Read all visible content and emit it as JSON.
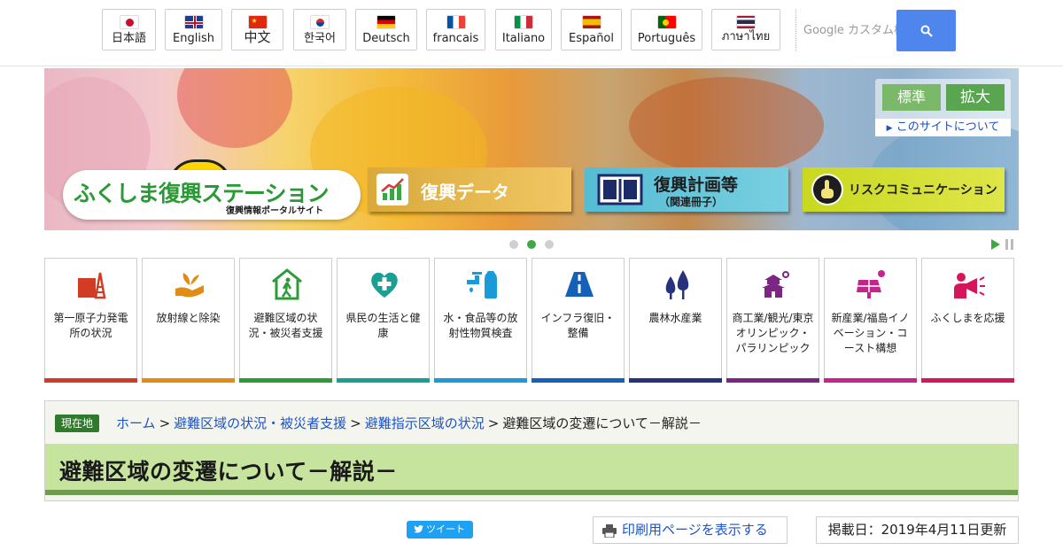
{
  "languages": [
    {
      "label": "日本語",
      "flag": "jp"
    },
    {
      "label": "English",
      "flag": "uk"
    },
    {
      "label": "中文",
      "flag": "cn"
    },
    {
      "label": "한국어",
      "flag": "kr"
    },
    {
      "label": "Deutsch",
      "flag": "de"
    },
    {
      "label": "francais",
      "flag": "fr"
    },
    {
      "label": "Italiano",
      "flag": "it"
    },
    {
      "label": "Español",
      "flag": "es"
    },
    {
      "label": "Português",
      "flag": "pt"
    },
    {
      "label": "ภาษาไทย",
      "flag": "th"
    }
  ],
  "search": {
    "placeholder": "Google カスタム検索",
    "icon": "search-icon",
    "button_color": "#4f86ee"
  },
  "hero": {
    "logo_title": "ふくしま復興ステーション",
    "logo_subtitle": "復興情報ポータルサイト",
    "buttons": [
      {
        "label": "復興データ",
        "icon": "chart-icon"
      },
      {
        "label": "復興計画等",
        "sublabel": "（関連冊子）",
        "icon": "book-icon"
      },
      {
        "label": "リスクコミュニケーション",
        "icon": "hand-icon"
      }
    ],
    "font_size": {
      "standard": "標準",
      "large": "拡大"
    },
    "about_link": "このサイトについて",
    "slider": {
      "total": 3,
      "active": 2
    }
  },
  "categories": [
    {
      "label": "第一原子力発電所の状況",
      "color": "#d33c24",
      "icon": "power-plant-icon"
    },
    {
      "label": "放射線と除染",
      "color": "#e38c14",
      "icon": "hand-sprout-icon"
    },
    {
      "label": "避難区域の状況・被災者支援",
      "color": "#2f9a3a",
      "icon": "evacuation-house-icon"
    },
    {
      "label": "県民の生活と健康",
      "color": "#1a9f93",
      "icon": "health-heart-icon"
    },
    {
      "label": "水・食品等の放射性物質検査",
      "color": "#1a9ad6",
      "icon": "water-milk-icon"
    },
    {
      "label": "インフラ復旧・整備",
      "color": "#1560b8",
      "icon": "road-icon"
    },
    {
      "label": "農林水産業",
      "color": "#27327c",
      "icon": "trees-icon"
    },
    {
      "label": "商工業/観光/東京オリンピック・パラリンピック",
      "color": "#7a2682",
      "icon": "castle-icon"
    },
    {
      "label": "新産業/福島イノベーション・コースト構想",
      "color": "#c5248a",
      "icon": "solar-panel-icon"
    },
    {
      "label": "ふくしまを応援",
      "color": "#d6165a",
      "icon": "megaphone-icon"
    }
  ],
  "breadcrumb": {
    "here_label": "現在地",
    "items": [
      "ホーム",
      "避難区域の状況・被災者支援",
      "避難指示区域の状況"
    ],
    "current": "避難区域の変遷について－解説－"
  },
  "page_title": "避難区域の変遷について－解説－",
  "toolbar": {
    "tweet": "ツイート",
    "print": "印刷用ページを表示する",
    "updated": "掲載日：2019年4月11日更新"
  }
}
